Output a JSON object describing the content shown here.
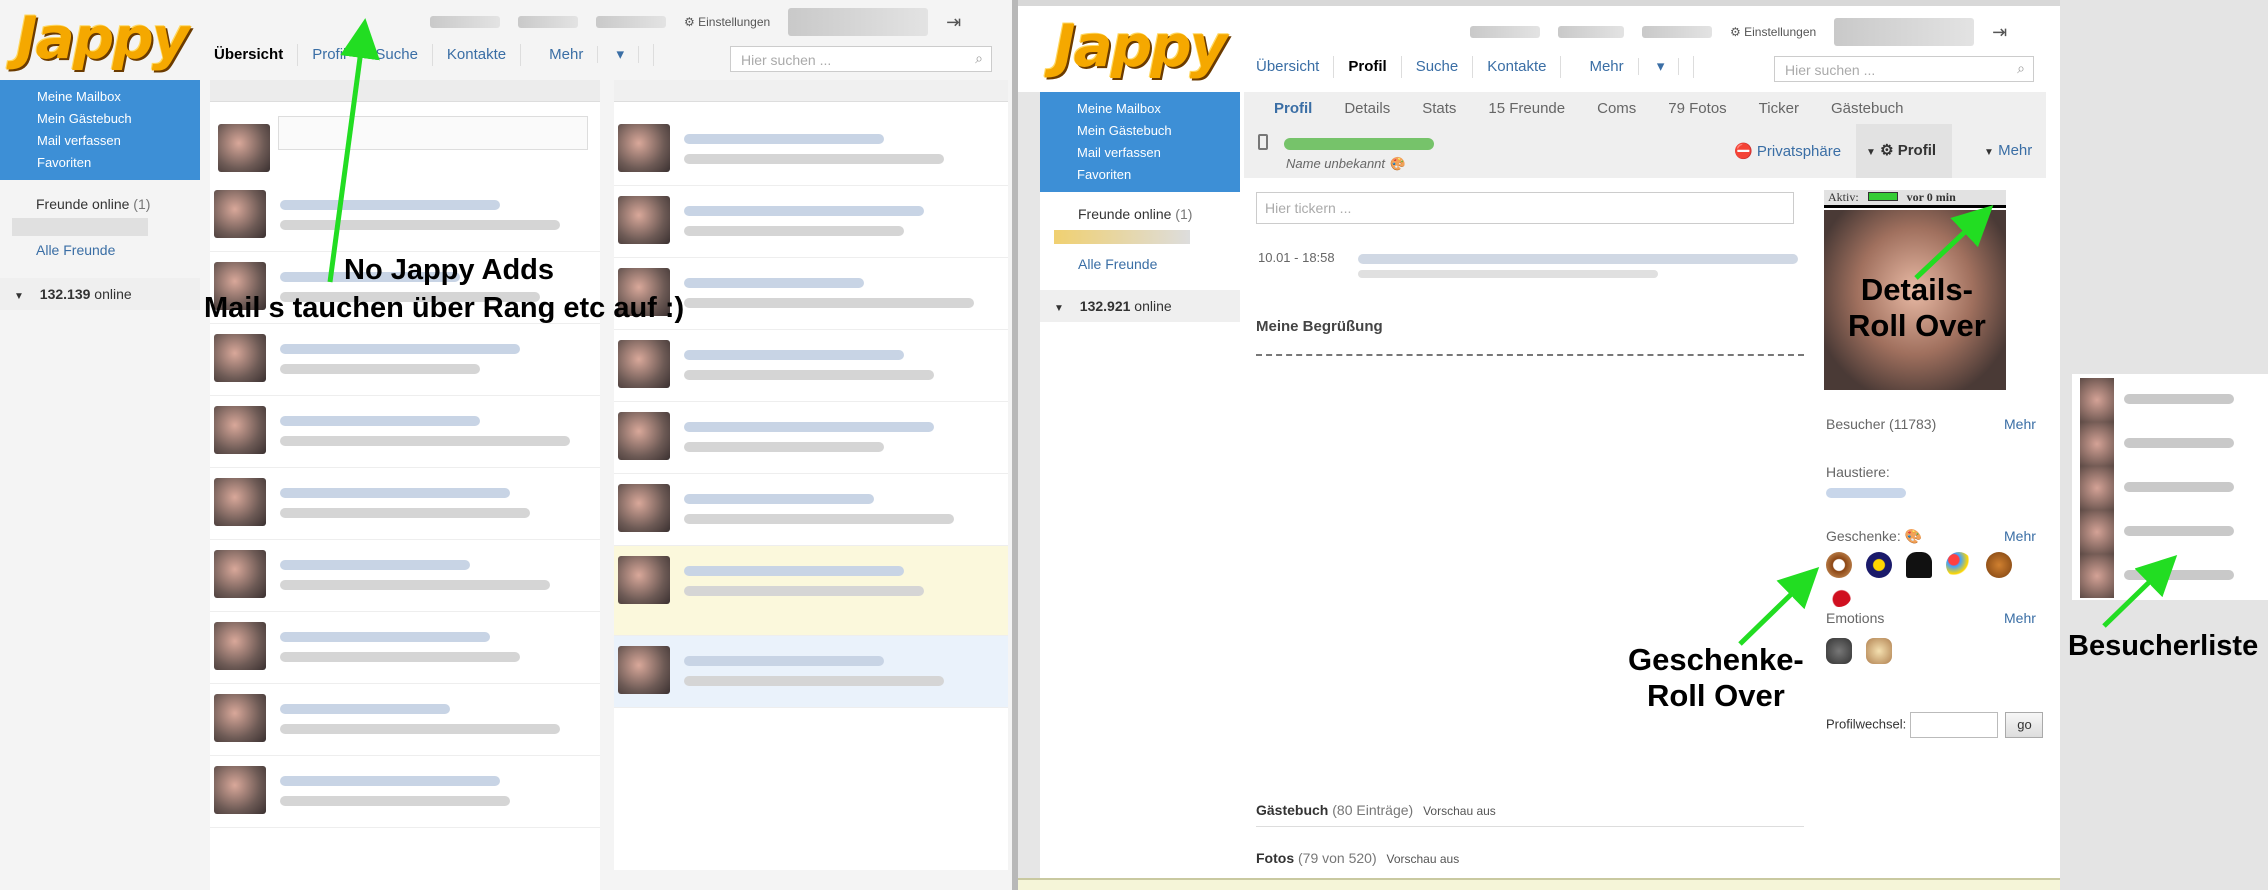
{
  "left": {
    "logo": "Jappy",
    "header": {
      "settings": "Einstellungen"
    },
    "tabs": [
      "Übersicht",
      "Profil",
      "Suche",
      "Kontakte",
      "Mehr"
    ],
    "active_tab": "Übersicht",
    "search_placeholder": "Hier suchen ...",
    "sidebar_menu": [
      "Meine Mailbox",
      "Mein Gästebuch",
      "Mail verfassen",
      "Favoriten"
    ],
    "friends_online_label": "Freunde online",
    "friends_online_count": "(1)",
    "all_friends": "Alle Freunde",
    "online_count": "132.139",
    "online_label": "online"
  },
  "annotations": {
    "no_ads": "No Jappy Adds",
    "mails": "Mail s tauchen über Rang etc auf :)",
    "details_line1": "Details-",
    "details_line2": "Roll Over",
    "gifts_line1": "Geschenke-",
    "gifts_line2": "Roll Over",
    "visitors": "Besucherliste"
  },
  "right": {
    "logo": "Jappy",
    "header": {
      "settings": "Einstellungen"
    },
    "tabs": [
      "Übersicht",
      "Profil",
      "Suche",
      "Kontakte",
      "Mehr"
    ],
    "active_tab": "Profil",
    "search_placeholder": "Hier suchen ...",
    "sidebar_menu": [
      "Meine Mailbox",
      "Mein Gästebuch",
      "Mail verfassen",
      "Favoriten"
    ],
    "friends_online_label": "Freunde online",
    "friends_online_count": "(1)",
    "all_friends": "Alle Freunde",
    "online_count": "132.921",
    "online_label": "online",
    "subtabs": [
      "Profil",
      "Details",
      "Stats",
      "15 Freunde",
      "Coms",
      "79 Fotos",
      "Ticker",
      "Gästebuch"
    ],
    "active_subtab": "Profil",
    "name_unknown": "Name unbekannt",
    "privacy": "Privatsphäre",
    "profile_btn": "Profil",
    "more_btn": "Mehr",
    "ticker_placeholder": "Hier tickern ...",
    "ticker_time": "10.01 - 18:58",
    "welcome_heading": "Meine Begrüßung",
    "activity_label": "Aktiv:",
    "activity_time": "vor 0 min",
    "visitors_label": "Besucher (11783)",
    "visitors_more": "Mehr",
    "pets_label": "Haustiere:",
    "gifts_label": "Geschenke:",
    "gifts_more": "Mehr",
    "emotions_label": "Emotions",
    "emotions_more": "Mehr",
    "profile_switch_label": "Profilwechsel:",
    "go_btn": "go",
    "guestbook_label": "Gästebuch",
    "guestbook_count": "(80 Einträge)",
    "guestbook_preview": "Vorschau aus",
    "photos_label": "Fotos",
    "photos_count": "(79 von 520)",
    "photos_preview": "Vorschau aus"
  },
  "colors": {
    "accent_blue": "#3d8fd6",
    "link": "#3a6ea5",
    "logo": "#f5a800",
    "arrow": "#22dd22"
  }
}
